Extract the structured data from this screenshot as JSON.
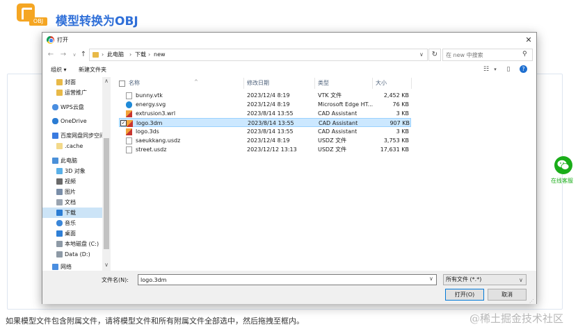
{
  "page": {
    "badge": "OBJ",
    "title": "模型转换为OBJ",
    "hint": "如果模型文件包含附属文件，请将模型文件和所有附属文件全部选中，然后拖拽至框内。",
    "watermark": "@稀土掘金技术社区",
    "wechat_label": "在线客服"
  },
  "dialog": {
    "title": "打开",
    "close_icon": "close-icon",
    "nav": {
      "back": "←",
      "forward": "→",
      "dropdown": "∨",
      "up": "↑",
      "breadcrumbs": [
        "此电脑",
        "下载",
        "new"
      ],
      "refresh": "↻",
      "search_placeholder": "在 new 中搜索"
    },
    "toolbar": {
      "organize": "组织 ▾",
      "new_folder": "新建文件夹"
    },
    "sidebar": {
      "items": [
        {
          "label": "封面",
          "icon": "folder-icon"
        },
        {
          "label": "运营推广",
          "icon": "folder-icon"
        },
        {
          "label": "WPS云盘",
          "icon": "cloud-icon"
        },
        {
          "label": "OneDrive",
          "icon": "cloud-icon"
        },
        {
          "label": "百度网盘同步空间",
          "icon": "sync-icon"
        },
        {
          "label": ".cache",
          "icon": "folder-icon"
        },
        {
          "label": "此电脑",
          "icon": "computer-icon"
        },
        {
          "label": "3D 对象",
          "icon": "cube-icon"
        },
        {
          "label": "视频",
          "icon": "video-icon"
        },
        {
          "label": "图片",
          "icon": "picture-icon"
        },
        {
          "label": "文档",
          "icon": "document-icon"
        },
        {
          "label": "下载",
          "icon": "download-icon"
        },
        {
          "label": "音乐",
          "icon": "music-icon"
        },
        {
          "label": "桌面",
          "icon": "desktop-icon"
        },
        {
          "label": "本地磁盘 (C:)",
          "icon": "disk-icon"
        },
        {
          "label": "Data (D:)",
          "icon": "disk-icon"
        },
        {
          "label": "网络",
          "icon": "network-icon"
        }
      ],
      "selected": "下载"
    },
    "columns": {
      "name": "名称",
      "modified": "修改日期",
      "type": "类型",
      "size": "大小"
    },
    "files": [
      {
        "name": "bunny.vtk",
        "modified": "2023/12/4 8:19",
        "type": "VTK 文件",
        "size": "2,452 KB",
        "icon": "file-icon",
        "selected": false
      },
      {
        "name": "energy.svg",
        "modified": "2023/12/4 8:19",
        "type": "Microsoft Edge HT...",
        "size": "76 KB",
        "icon": "edge-icon",
        "selected": false
      },
      {
        "name": "extrusion3.wrl",
        "modified": "2023/8/14 13:55",
        "type": "CAD Assistant",
        "size": "3 KB",
        "icon": "cad-icon",
        "selected": false
      },
      {
        "name": "logo.3dm",
        "modified": "2023/8/14 13:55",
        "type": "CAD Assistant",
        "size": "907 KB",
        "icon": "cad-icon",
        "selected": true
      },
      {
        "name": "logo.3ds",
        "modified": "2023/8/14 13:55",
        "type": "CAD Assistant",
        "size": "3 KB",
        "icon": "cad-icon",
        "selected": false
      },
      {
        "name": "saeukkang.usdz",
        "modified": "2023/12/4 8:19",
        "type": "USDZ 文件",
        "size": "3,753 KB",
        "icon": "file-icon",
        "selected": false
      },
      {
        "name": "street.usdz",
        "modified": "2023/12/12 13:13",
        "type": "USDZ 文件",
        "size": "17,631 KB",
        "icon": "file-icon",
        "selected": false
      }
    ],
    "footer": {
      "filename_label": "文件名(N):",
      "filename_value": "logo.3dm",
      "filetype": "所有文件 (*.*)",
      "open": "打开(O)",
      "cancel": "取消"
    }
  },
  "colors": {
    "accent": "#2f6fd8",
    "logo": "#f5a623",
    "selection": "#cce8ff",
    "wechat": "#1aad19"
  }
}
